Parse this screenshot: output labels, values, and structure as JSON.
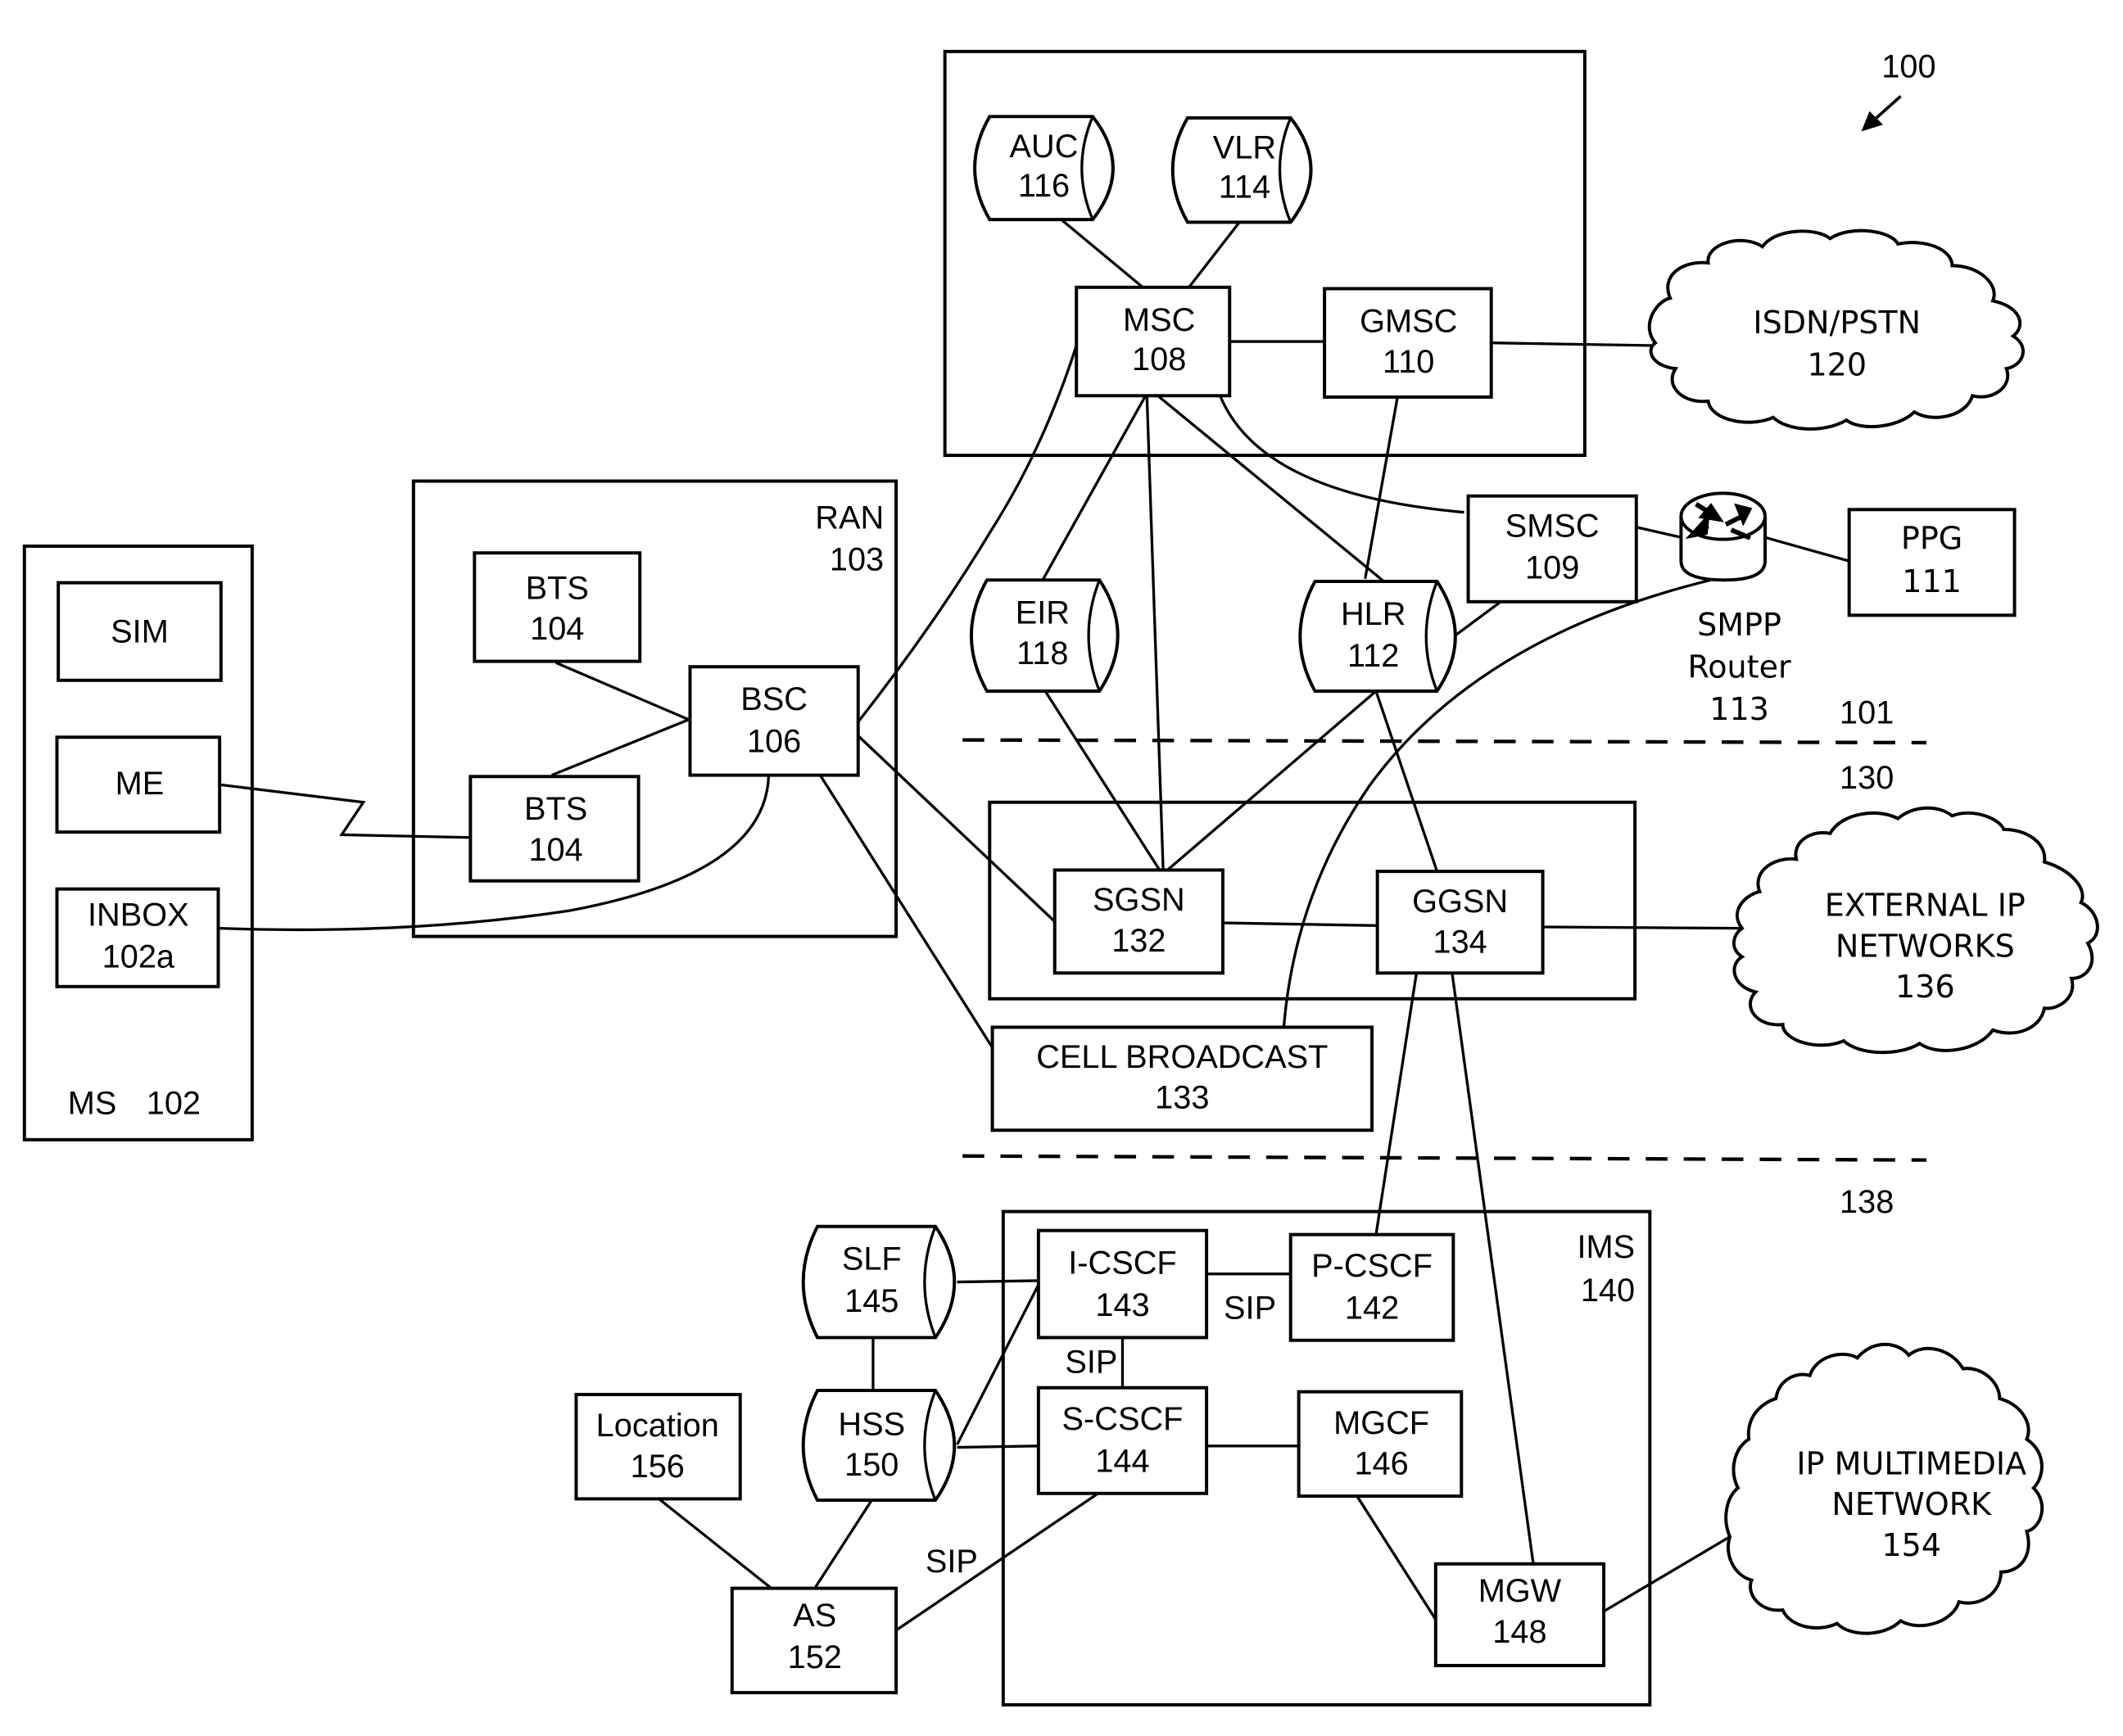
{
  "figure": {
    "reference": "100",
    "reference_arrow_icon": "arrow-down-left"
  },
  "mobile_station": {
    "label": "MS",
    "number": "102",
    "components": [
      {
        "label": "SIM",
        "number": ""
      },
      {
        "label": "ME",
        "number": ""
      },
      {
        "label": "INBOX",
        "number": "102a"
      }
    ]
  },
  "ran": {
    "label": "RAN",
    "number": "103",
    "nodes": [
      {
        "label": "BTS",
        "number": "104"
      },
      {
        "label": "BTS",
        "number": "104"
      },
      {
        "label": "BSC",
        "number": "106"
      }
    ]
  },
  "core_network": {
    "nodes": [
      {
        "id": "auc",
        "label": "AUC",
        "number": "116",
        "shape": "cylinder"
      },
      {
        "id": "vlr",
        "label": "VLR",
        "number": "114",
        "shape": "cylinder"
      },
      {
        "id": "msc",
        "label": "MSC",
        "number": "108",
        "shape": "box"
      },
      {
        "id": "gmsc",
        "label": "GMSC",
        "number": "110",
        "shape": "box"
      }
    ]
  },
  "switching_nodes": [
    {
      "id": "smsc",
      "label": "SMSC",
      "number": "109",
      "shape": "box"
    },
    {
      "id": "eir",
      "label": "EIR",
      "number": "118",
      "shape": "cylinder"
    },
    {
      "id": "hlr",
      "label": "HLR",
      "number": "112",
      "shape": "cylinder"
    },
    {
      "id": "ppg",
      "label": "PPG",
      "number": "111",
      "shape": "box"
    }
  ],
  "smpp_router": {
    "line1": "SMPP",
    "line2": "Router",
    "number": "113",
    "icon": "router-icon"
  },
  "clouds": [
    {
      "id": "isdn",
      "lines": [
        "ISDN/PSTN",
        "120"
      ]
    },
    {
      "id": "external-ip",
      "lines": [
        "EXTERNAL IP",
        "NETWORKS",
        "136"
      ]
    },
    {
      "id": "ip-multimedia",
      "lines": [
        "IP MULTIMEDIA",
        "NETWORK",
        "154"
      ]
    }
  ],
  "gprs": {
    "nodes": [
      {
        "id": "sgsn",
        "label": "SGSN",
        "number": "132"
      },
      {
        "id": "ggsn",
        "label": "GGSN",
        "number": "134"
      }
    ]
  },
  "cell_broadcast": {
    "label": "CELL BROADCAST",
    "number": "133"
  },
  "section_labels": {
    "above_line_1": "101",
    "below_line_1": "130",
    "below_line_2": "138"
  },
  "ims": {
    "label": "IMS",
    "number": "140",
    "nodes": [
      {
        "id": "icscf",
        "label": "I-CSCF",
        "number": "143"
      },
      {
        "id": "pcscf",
        "label": "P-CSCF",
        "number": "142"
      },
      {
        "id": "scscf",
        "label": "S-CSCF",
        "number": "144"
      },
      {
        "id": "mgcf",
        "label": "MGCF",
        "number": "146"
      },
      {
        "id": "mgw",
        "label": "MGW",
        "number": "148"
      }
    ]
  },
  "ims_external": [
    {
      "id": "slf",
      "label": "SLF",
      "number": "145",
      "shape": "cylinder"
    },
    {
      "id": "hss",
      "label": "HSS",
      "number": "150",
      "shape": "cylinder"
    },
    {
      "id": "location",
      "label": "Location",
      "number": "156",
      "shape": "box"
    },
    {
      "id": "as",
      "label": "AS",
      "number": "152",
      "shape": "box"
    }
  ],
  "link_labels": {
    "icscf_pcscf": "SIP",
    "icscf_scscf": "SIP",
    "as_scscf": "SIP"
  }
}
